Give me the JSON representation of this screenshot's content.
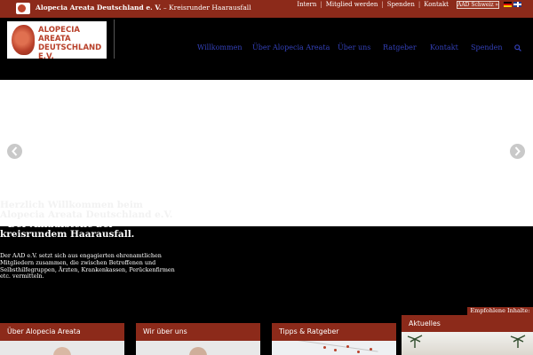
{
  "topbar": {
    "site_name": "Alopecia Areata Deutschland e. V.",
    "tagline": " – Kreisrunder Haarausfall",
    "links": [
      "Intern",
      "Mitglied werden",
      "Spenden",
      "Kontakt"
    ],
    "separator": "|",
    "aad_button": "AAD Schweiz »"
  },
  "brand": {
    "lines": [
      "ALOPECIA",
      "AREATA",
      "DEUTSCHLAND E.V."
    ]
  },
  "nav": {
    "items": [
      "Willkommen",
      "Über Alopecia Areata",
      "Über uns",
      "Ratgeber",
      "Kontakt",
      "Spenden"
    ]
  },
  "hero": {
    "title_light": "Herzlich Willkommen beim Alopecia Areata Deutschland e.V.",
    "title_strong": "– Der Anlaufstelle bei kreisrundem Haarausfall.",
    "body": "Der AAD e.V. setzt sich aus engagierten ehrenamtlichen Mitgliedern zusammen, die zwischen Betroffenen und Selbsthilfegruppen, Ärzten, Krankenkassen, Perückenfirmen etc. vermitteln."
  },
  "recommended": "Empfohlene Inhalte:",
  "cards": [
    {
      "title": "Über Alopecia Areata"
    },
    {
      "title": "Wir über uns"
    },
    {
      "title": "Tipps & Ratgeber"
    },
    {
      "title": "Aktuelles"
    }
  ],
  "colors": {
    "accent": "#8c2a1a",
    "nav_link": "#3340b8",
    "brand_text": "#b8402a"
  },
  "icons": [
    "aad-logo-icon",
    "flag-de-icon",
    "flag-gb-icon",
    "search-icon",
    "arrow-left-icon",
    "arrow-right-icon"
  ]
}
